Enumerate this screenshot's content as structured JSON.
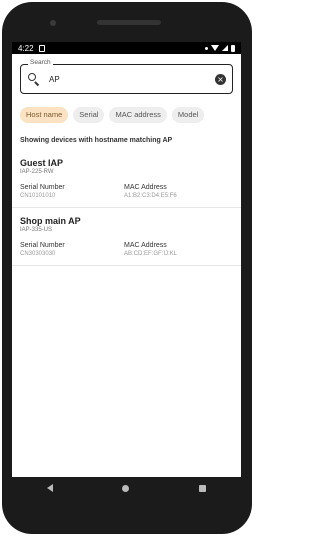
{
  "statusbar": {
    "time": "4:22"
  },
  "search": {
    "label": "Search",
    "value": "AP"
  },
  "filters": [
    {
      "label": "Host name",
      "selected": true
    },
    {
      "label": "Serial",
      "selected": false
    },
    {
      "label": "MAC address",
      "selected": false
    },
    {
      "label": "Model",
      "selected": false
    }
  ],
  "summary": "Showing devices with hostname matching AP",
  "devices": [
    {
      "name": "Guest IAP",
      "model": "IAP-225-RW",
      "serial_label": "Serial Number",
      "serial": "CN10101010",
      "mac_label": "MAC Address",
      "mac": "A1:B2:C3:D4:E5:F6"
    },
    {
      "name": "Shop main AP",
      "model": "IAP-335-US",
      "serial_label": "Serial Number",
      "serial": "CN30303030",
      "mac_label": "MAC Address",
      "mac": "AB:CD:EF:GF:IJ:KL"
    }
  ],
  "colors": {
    "frame": "#1b1b1b",
    "chip_selected_bg": "#fbe2c2",
    "chip_bg": "#eeeeee",
    "divider": "#e6e6e6"
  },
  "icons": {
    "search": "search-icon",
    "clear": "clear-icon",
    "nav_back": "back-icon",
    "nav_home": "home-icon",
    "nav_recent": "recent-apps-icon"
  }
}
